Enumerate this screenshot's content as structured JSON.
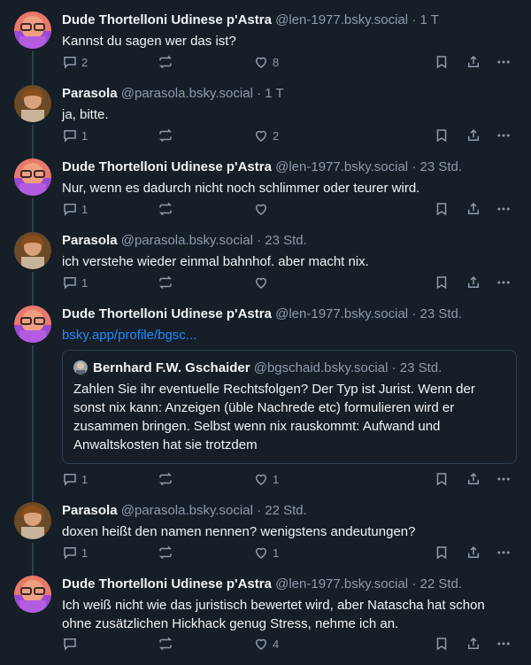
{
  "posts": [
    {
      "author": "Dude Thortelloni Udinese p'Astra",
      "handle": "@len-1977.bsky.social",
      "sep": "·",
      "time": "1 T",
      "text": "Kannst du sagen wer das ist?",
      "replies": "2",
      "reposts": "",
      "likes": "8",
      "avatar": "glasses-purple"
    },
    {
      "author": "Parasola",
      "handle": "@parasola.bsky.social",
      "sep": "·",
      "time": "1 T",
      "text": "ja, bitte.",
      "replies": "1",
      "reposts": "",
      "likes": "2",
      "avatar": "portrait-painting"
    },
    {
      "author": "Dude Thortelloni Udinese p'Astra",
      "handle": "@len-1977.bsky.social",
      "sep": "·",
      "time": "23 Std.",
      "text": "Nur, wenn es dadurch nicht noch schlimmer oder teurer wird.",
      "replies": "1",
      "reposts": "",
      "likes": "",
      "avatar": "glasses-purple"
    },
    {
      "author": "Parasola",
      "handle": "@parasola.bsky.social",
      "sep": "·",
      "time": "23 Std.",
      "text": "ich verstehe wieder einmal bahnhof. aber macht nix.",
      "replies": "1",
      "reposts": "",
      "likes": "",
      "avatar": "portrait-painting"
    },
    {
      "author": "Dude Thortelloni Udinese p'Astra",
      "handle": "@len-1977.bsky.social",
      "sep": "·",
      "time": "23 Std.",
      "link": "bsky.app/profile/bgsc...",
      "replies": "1",
      "reposts": "",
      "likes": "1",
      "avatar": "glasses-purple",
      "quote": {
        "author": "Bernhard F.W. Gschaider",
        "handle": "@bgschaid.bsky.social",
        "sep": "·",
        "time": "23 Std.",
        "text": "Zahlen Sie ihr eventuelle Rechtsfolgen? Der Typ ist Jurist. Wenn der sonst nix kann: Anzeigen (üble Nachrede etc) formulieren wird er zusammen bringen. Selbst wenn nix rauskommt: Aufwand und Anwaltskosten hat sie trotzdem"
      }
    },
    {
      "author": "Parasola",
      "handle": "@parasola.bsky.social",
      "sep": "·",
      "time": "22 Std.",
      "text": "doxen heißt den namen nennen? wenigstens andeutungen?",
      "replies": "1",
      "reposts": "",
      "likes": "1",
      "avatar": "portrait-painting"
    },
    {
      "author": "Dude Thortelloni Udinese p'Astra",
      "handle": "@len-1977.bsky.social",
      "sep": "·",
      "time": "22 Std.",
      "text": "Ich weiß nicht wie das juristisch bewertet wird, aber Natascha hat schon ohne zusätzlichen Hickhack genug Stress, nehme ich an.",
      "replies": "",
      "reposts": "",
      "likes": "4",
      "avatar": "glasses-purple"
    }
  ],
  "icons": {
    "reply": "reply-icon",
    "repost": "repost-icon",
    "like": "heart-icon",
    "bookmark": "bookmark-icon",
    "share": "share-icon",
    "more": "more-icon"
  },
  "colors": {
    "background": "#161e27",
    "text": "#f1f3f5",
    "muted": "#8d9bab",
    "link": "#208bfe",
    "border": "#2e4052"
  }
}
